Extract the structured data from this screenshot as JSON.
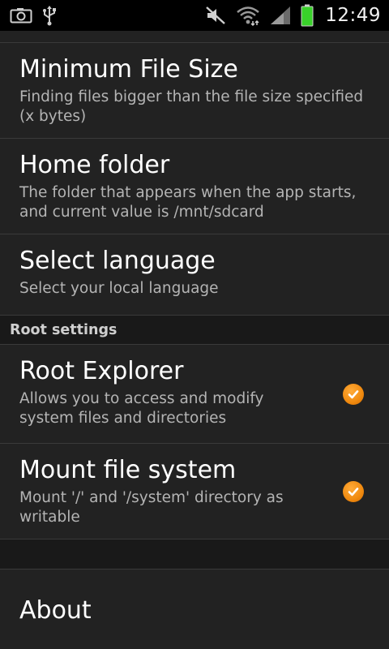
{
  "status_bar": {
    "time": "12:49",
    "left_icons": [
      "screenshot-icon",
      "usb-icon"
    ],
    "right_icons": [
      "mute-icon",
      "wifi-icon",
      "signal-icon",
      "battery-icon"
    ],
    "battery_color": "#39d12a"
  },
  "settings": {
    "items": [
      {
        "title": "Minimum File Size",
        "summary": "Finding files bigger than the file size specified (x bytes)"
      },
      {
        "title": "Home folder",
        "summary": "The folder that appears when the app starts, and current value is /mnt/sdcard"
      },
      {
        "title": "Select language",
        "summary": "Select your local language"
      }
    ],
    "root_category": "Root settings",
    "root_items": [
      {
        "title": "Root Explorer",
        "summary": "Allows you to access and modify system files and directories",
        "checked": true
      },
      {
        "title": "Mount file system",
        "summary": "Mount '/' and '/system' directory as writable",
        "checked": true
      }
    ],
    "about": {
      "title": "About"
    }
  },
  "colors": {
    "background": "#222222",
    "category_background": "#191919",
    "accent_check": "#f08a0f",
    "title_text": "#ffffff",
    "summary_text": "#b4b4b4"
  }
}
